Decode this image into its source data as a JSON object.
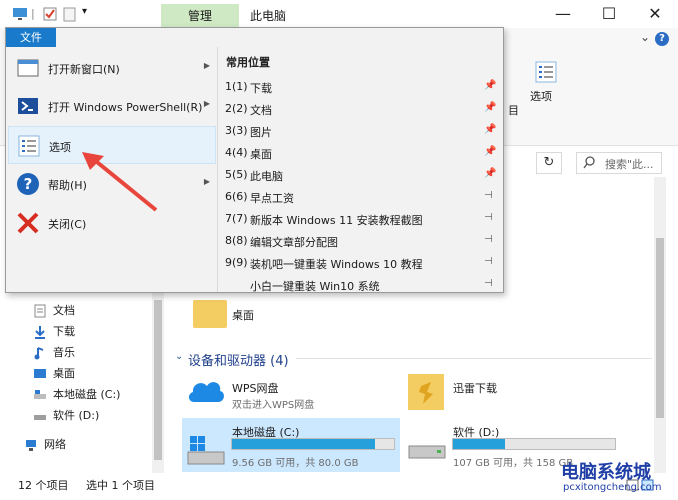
{
  "titlebar": {
    "tab_manage": "管理",
    "title": "此电脑",
    "minimize": "—",
    "maximize": "☐",
    "close": "✕"
  },
  "ribbon": {
    "options_label": "选项",
    "collapse_glyph": "⌄",
    "help_glyph": "?"
  },
  "address": {
    "refresh_glyph": "↻",
    "search_placeholder": "搜索\"此..."
  },
  "file_menu": {
    "tab_label": "文件",
    "items": [
      {
        "label": "打开新窗口(N)",
        "has_arrow": true
      },
      {
        "label": "打开 Windows PowerShell(R)",
        "has_arrow": true
      },
      {
        "label": "选项",
        "has_arrow": false
      },
      {
        "label": "帮助(H)",
        "has_arrow": true
      },
      {
        "label": "关闭(C)",
        "has_arrow": false
      }
    ],
    "recent_title": "常用位置",
    "recent": [
      {
        "num": "1(1)",
        "label": "下载",
        "pin": "📌"
      },
      {
        "num": "2(2)",
        "label": "文档",
        "pin": "📌"
      },
      {
        "num": "3(3)",
        "label": "图片",
        "pin": "📌"
      },
      {
        "num": "4(4)",
        "label": "桌面",
        "pin": "📌"
      },
      {
        "num": "5(5)",
        "label": "此电脑",
        "pin": "📌"
      },
      {
        "num": "6(6)",
        "label": "早点工资",
        "pin": "⊣"
      },
      {
        "num": "7(7)",
        "label": "新版本 Windows 11 安装教程截图",
        "pin": "⊣"
      },
      {
        "num": "8(8)",
        "label": "编辑文章部分配图",
        "pin": "⊣"
      },
      {
        "num": "9(9)",
        "label": "装机吧一键重装 Windows 10 教程",
        "pin": "⊣"
      },
      {
        "num": "",
        "label": "小白一键重装 Win10 系统",
        "pin": "⊣"
      }
    ]
  },
  "nav": {
    "items": [
      {
        "label": "文档"
      },
      {
        "label": "下载"
      },
      {
        "label": "音乐"
      },
      {
        "label": "桌面"
      },
      {
        "label": "本地磁盘 (C:)"
      },
      {
        "label": "软件 (D:)"
      },
      {
        "label": "网络"
      }
    ]
  },
  "content": {
    "desktop_label": "桌面",
    "section_toggle": "⌄",
    "section_title": "设备和驱动器 (4)",
    "wps": {
      "name": "WPS网盘",
      "sub": "双击进入WPS网盘"
    },
    "xunlei": {
      "name": "迅雷下载"
    },
    "drive_c": {
      "name": "本地磁盘 (C:)",
      "sub": "9.56 GB 可用，共 80.0 GB",
      "used_fraction": 0.88
    },
    "drive_d": {
      "name": "软件 (D:)",
      "sub": "107 GB 可用，共 158 GB",
      "used_fraction": 0.32
    }
  },
  "status": {
    "count": "12 个项目",
    "selected": "选中 1 个项目"
  },
  "watermark": {
    "title": "电脑系统城",
    "sub": "pcxitongcheng.com"
  },
  "colors": {
    "accent": "#1979ca",
    "manage_tab": "#cfe9c5",
    "selection": "#cce8ff",
    "annotation_arrow": "#e8463c"
  }
}
